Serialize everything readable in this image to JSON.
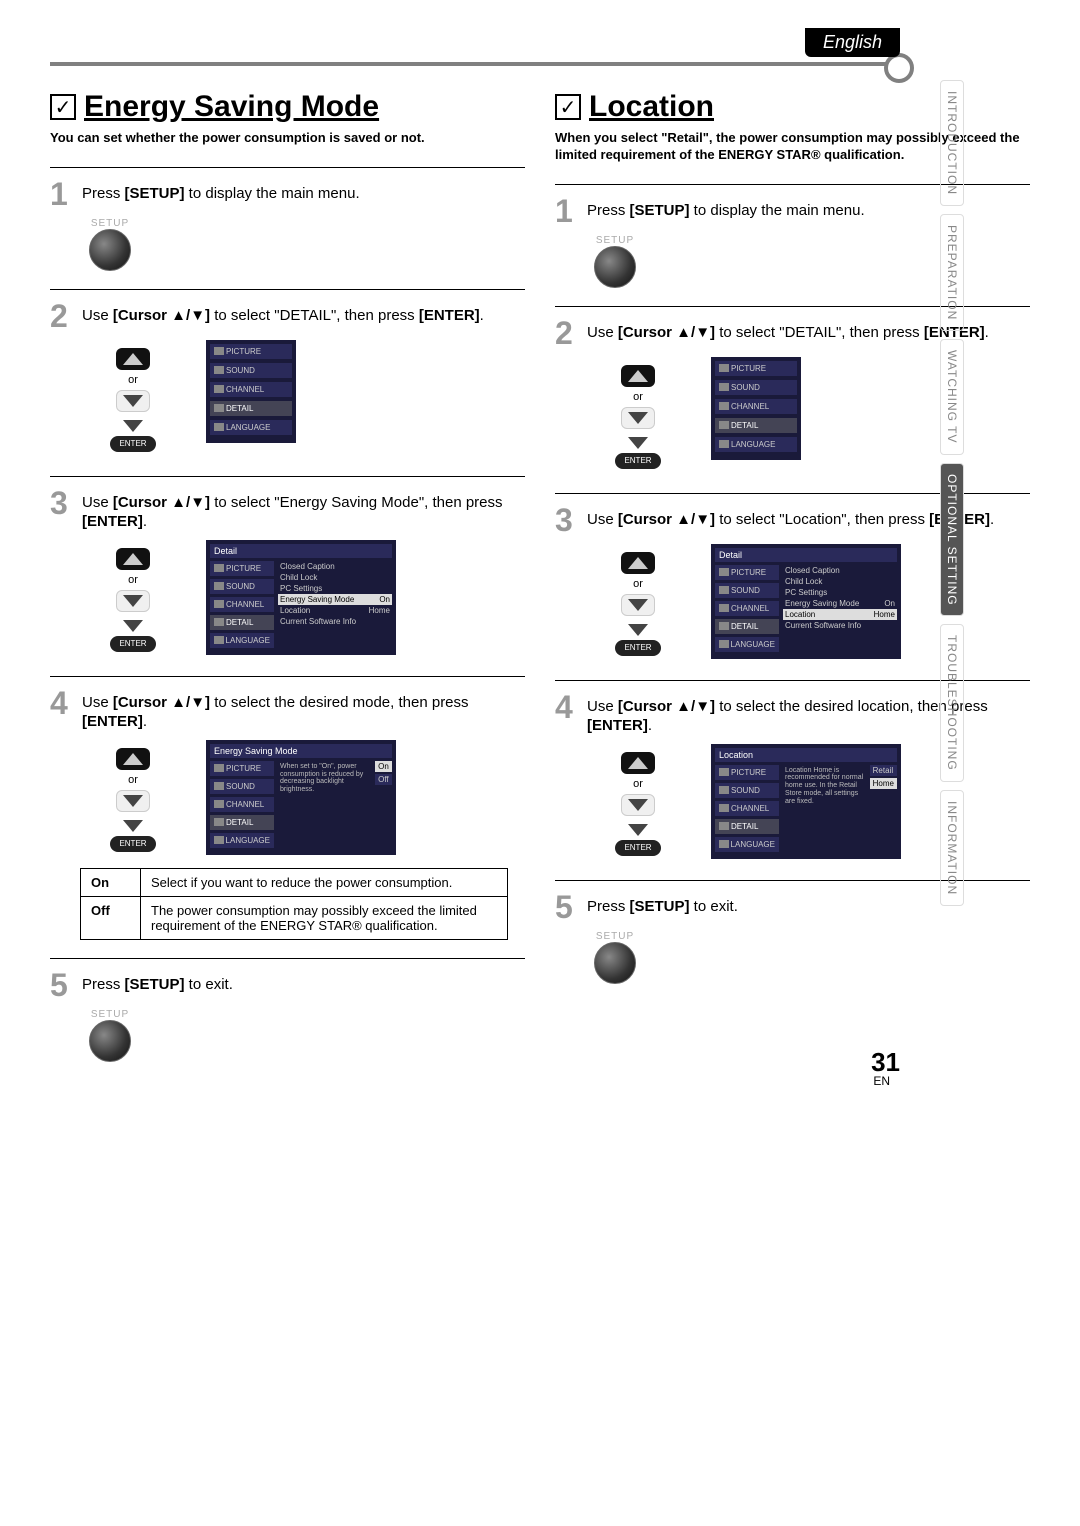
{
  "language_tab": "English",
  "sidebar": {
    "items": [
      "INTRODUCTION",
      "PREPARATION",
      "WATCHING TV",
      "OPTIONAL SETTING",
      "TROUBLESHOOTING",
      "INFORMATION"
    ],
    "active_index": 3
  },
  "left": {
    "title": "Energy Saving Mode",
    "intro": "You can set whether the power consumption is saved or not.",
    "steps": {
      "s1": {
        "num": "1",
        "pre": "Press ",
        "b1": "[SETUP]",
        "post": " to display the main menu."
      },
      "s2": {
        "num": "2",
        "pre": "Use ",
        "b1": "[Cursor ▲/▼]",
        "mid": " to select \"DETAIL\", then press ",
        "b2": "[ENTER]",
        "post": "."
      },
      "s3": {
        "num": "3",
        "pre": "Use ",
        "b1": "[Cursor ▲/▼]",
        "mid": " to select \"Energy Saving Mode\", then press ",
        "b2": "[ENTER]",
        "post": "."
      },
      "s4": {
        "num": "4",
        "pre": "Use ",
        "b1": "[Cursor ▲/▼]",
        "mid": " to select the desired mode, then press ",
        "b2": "[ENTER]",
        "post": "."
      },
      "s5": {
        "num": "5",
        "pre": "Press ",
        "b1": "[SETUP]",
        "post": " to exit."
      }
    },
    "table": {
      "on_label": "On",
      "on_desc": "Select if you want to reduce the power consumption.",
      "off_label": "Off",
      "off_desc": "The power consumption may possibly exceed the limited requirement of the ENERGY STAR® qualification."
    }
  },
  "right": {
    "title": "Location",
    "intro": "When you select \"Retail\", the power consumption may possibly exceed the limited requirement of the ENERGY STAR® qualification.",
    "steps": {
      "s1": {
        "num": "1",
        "pre": "Press ",
        "b1": "[SETUP]",
        "post": " to display the main menu."
      },
      "s2": {
        "num": "2",
        "pre": "Use ",
        "b1": "[Cursor ▲/▼]",
        "mid": " to select \"DETAIL\", then press ",
        "b2": "[ENTER]",
        "post": "."
      },
      "s3": {
        "num": "3",
        "pre": "Use ",
        "b1": "[Cursor ▲/▼]",
        "mid": " to select \"Location\", then press ",
        "b2": "[ENTER]",
        "post": "."
      },
      "s4": {
        "num": "4",
        "pre": "Use ",
        "b1": "[Cursor ▲/▼]",
        "mid": " to select the desired location, then press ",
        "b2": "[ENTER]",
        "post": "."
      },
      "s5": {
        "num": "5",
        "pre": "Press ",
        "b1": "[SETUP]",
        "post": " to exit."
      }
    }
  },
  "labels": {
    "setup": "SETUP",
    "enter": "ENTER",
    "or": "or"
  },
  "menu": {
    "tabs": [
      "PICTURE",
      "SOUND",
      "CHANNEL",
      "DETAIL",
      "LANGUAGE"
    ],
    "detail_title": "Detail",
    "detail_rows": [
      {
        "label": "Closed Caption",
        "val": ""
      },
      {
        "label": "Child Lock",
        "val": ""
      },
      {
        "label": "PC Settings",
        "val": ""
      },
      {
        "label": "Energy Saving Mode",
        "val": "On"
      },
      {
        "label": "Location",
        "val": "Home"
      },
      {
        "label": "Current Software Info",
        "val": ""
      }
    ],
    "esm_title": "Energy Saving Mode",
    "esm_note": "When set to \"On\", power consumption is reduced by decreasing backlight brightness.",
    "esm_opts": [
      "On",
      "Off"
    ],
    "loc_title": "Location",
    "loc_note": "Location Home is recommended for normal home use. In the Retail Store mode, all settings are fixed.",
    "loc_opts": [
      "Retail",
      "Home"
    ]
  },
  "page_number": "31",
  "page_lang": "EN"
}
